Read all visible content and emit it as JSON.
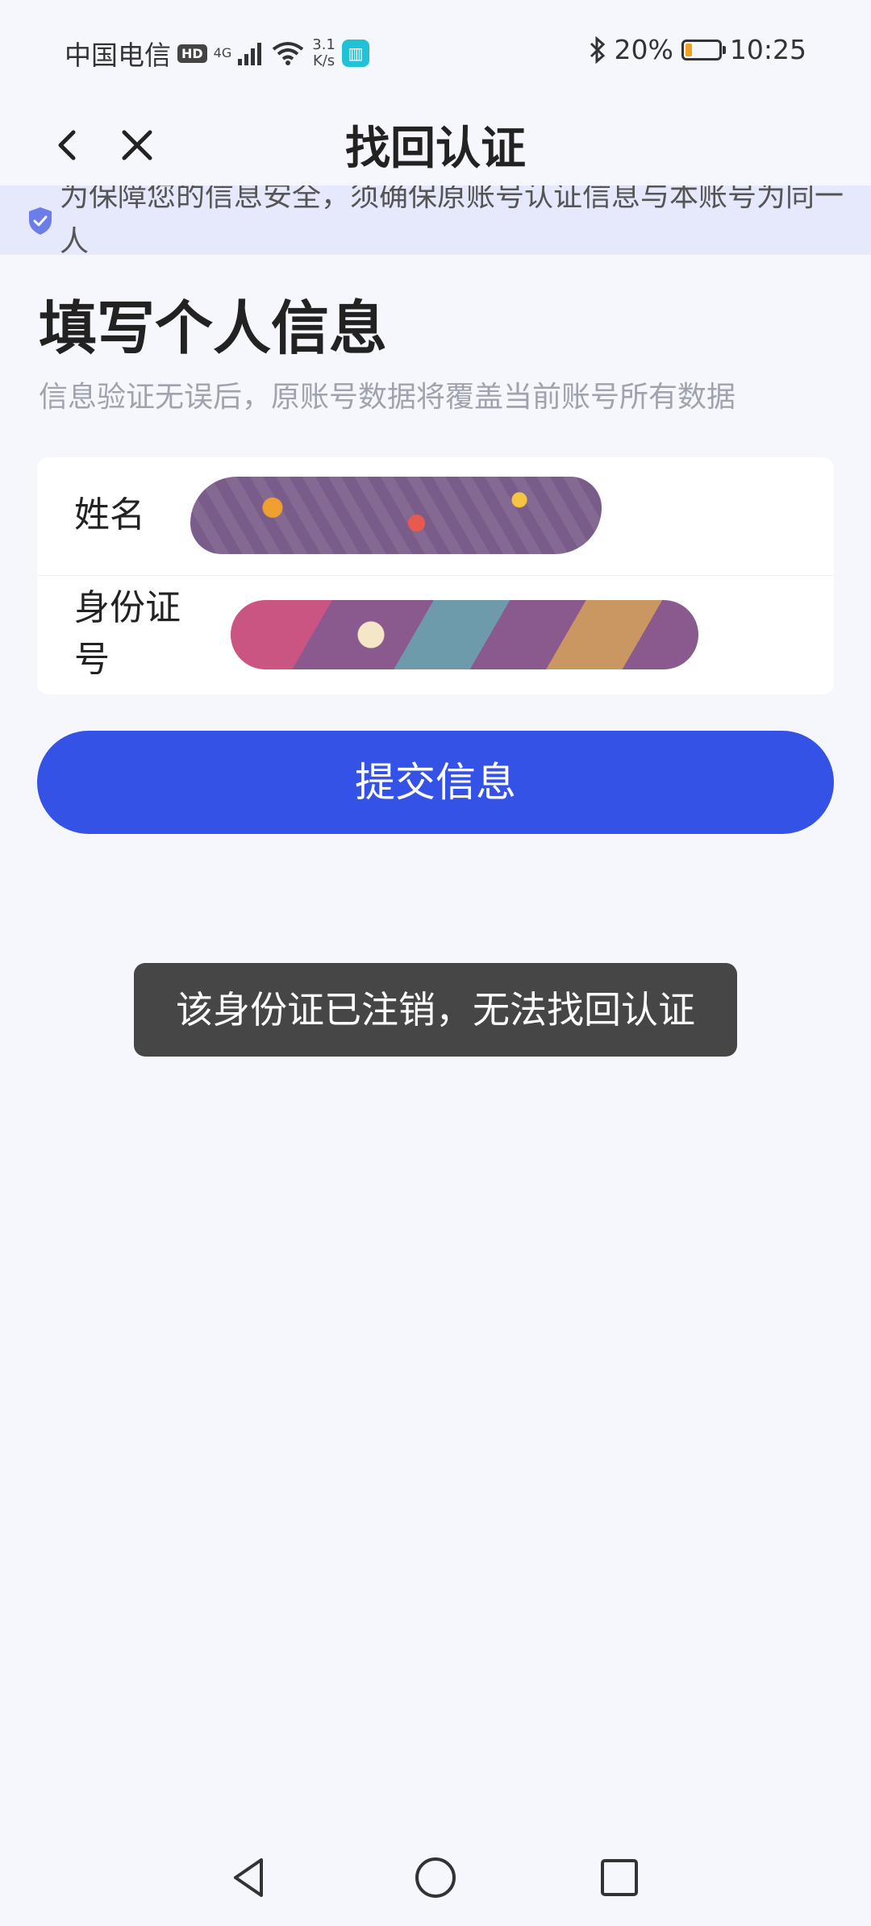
{
  "status_bar": {
    "carrier": "中国电信",
    "hd": "HD",
    "network_type": "4G",
    "speed_value": "3.1",
    "speed_unit": "K/s",
    "battery_percent": "20%",
    "battery_level": 0.2,
    "time": "10:25"
  },
  "nav": {
    "title": "找回认证"
  },
  "notice": {
    "text": "为保障您的信息安全，须确保原账号认证信息与本账号为同一人"
  },
  "section": {
    "title": "填写个人信息",
    "subtitle": "信息验证无误后，原账号数据将覆盖当前账号所有数据"
  },
  "form": {
    "name_label": "姓名",
    "id_label": "身份证号"
  },
  "submit": {
    "label": "提交信息"
  },
  "toast": {
    "message": "该身份证已注销，无法找回认证"
  },
  "colors": {
    "accent": "#3552e6",
    "banner_bg": "#e5e9fb",
    "page_bg": "#f6f7fd",
    "toast_bg": "#464646"
  }
}
